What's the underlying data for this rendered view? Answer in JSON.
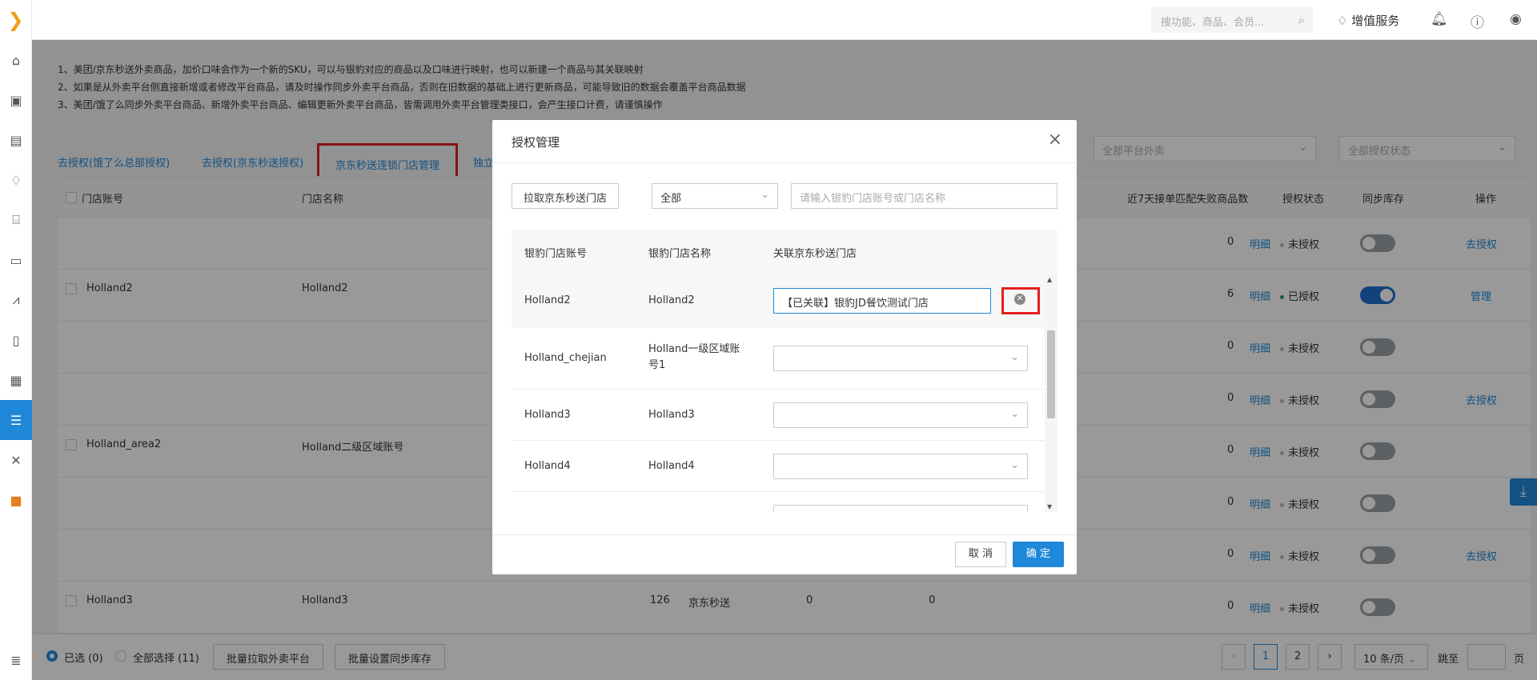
{
  "topbar": {
    "search_placeholder": "搜功能、商品、会员...",
    "value_added": "增值服务"
  },
  "icons": {
    "logo": "logo-icon",
    "search": "search-icon",
    "diamond": "diamond-icon",
    "bell": "bell-icon",
    "help": "help-icon",
    "user": "user-icon",
    "close": "close-icon",
    "clear": "clear-icon",
    "chevron": "chevron-down-icon",
    "download": "download-icon"
  },
  "sidebar": {
    "items": [
      "home-icon",
      "cashier-icon",
      "product-icon",
      "member-icon",
      "store-icon",
      "card-icon",
      "report-icon",
      "document-icon",
      "finance-icon",
      "settings-icon",
      "tools-icon",
      "apps-icon",
      "search-list-icon"
    ]
  },
  "notice": {
    "line1": "1、美团/京东秒送外卖商品，加价口味会作为一个新的SKU，可以与银豹对应的商品以及口味进行映射，也可以新建一个商品与其关联映射",
    "line2": "2、如果是从外卖平台侧直接新增或者修改平台商品，请及时操作同步外卖平台商品，否则在旧数据的基础上进行更新商品，可能导致旧的数据会覆盖平台商品数据",
    "line3": "3、美团/饿了么同步外卖平台商品、新增外卖平台商品、编辑更新外卖平台商品，皆需调用外卖平台管理类接口，会产生接口计费，请谨慎操作"
  },
  "tabs": {
    "t1": "去授权(饿了么总部授权)",
    "t2": "去授权(京东秒送授权)",
    "t3": "京东秒送连锁门店管理",
    "t4": "独立"
  },
  "filters": {
    "platform": "全部平台外卖",
    "auth_status": "全部授权状态",
    "partial": "3"
  },
  "table": {
    "headers": {
      "account": "门店账号",
      "name": "门店名称",
      "failed": "近7天接单匹配失败商品数",
      "auth": "授权状态",
      "sync": "同步库存",
      "ops": "操作"
    },
    "detail": "明细",
    "auth_yes": "已授权",
    "auth_no": "未授权",
    "op_auth": "去授权",
    "op_manage": "管理",
    "groups": [
      {
        "account": "Holland2",
        "name": "Holland2"
      },
      {
        "account": "Holland_area2",
        "name": "Holland二级区域账号"
      },
      {
        "account": "Holland3",
        "name": "Holland3",
        "count": "126",
        "platform": "京东秒送",
        "v1": "0",
        "v2": "0"
      }
    ],
    "rows": [
      {
        "fail": "0",
        "on": false,
        "op": "去授权"
      },
      {
        "fail": "6",
        "on": true,
        "op": "管理"
      },
      {
        "fail": "0",
        "on": false,
        "op": ""
      },
      {
        "fail": "0",
        "on": false,
        "op": "去授权"
      },
      {
        "fail": "0",
        "on": false,
        "op": ""
      },
      {
        "fail": "0",
        "on": false,
        "op": ""
      },
      {
        "fail": "0",
        "on": false,
        "op": "去授权"
      },
      {
        "fail": "0",
        "on": false,
        "op": ""
      }
    ]
  },
  "footer": {
    "selected": "已选 (0)",
    "select_all": "全部选择 (11)",
    "batch_pull": "批量拉取外卖平台",
    "batch_sync": "批量设置同步库存",
    "page1": "1",
    "page2": "2",
    "page_size": "10 条/页",
    "jump": "跳至",
    "page_unit": "页"
  },
  "modal": {
    "title": "授权管理",
    "pull_button": "拉取京东秒送门店",
    "filter_value": "全部",
    "search_placeholder": "请输入银豹门店账号或门店名称",
    "headers": {
      "account": "银豹门店账号",
      "name": "银豹门店名称",
      "link": "关联京东秒送门店"
    },
    "rows": [
      {
        "account": "Holland2",
        "name": "Holland2",
        "linked": "【已关联】银豹JD餐饮测试门店"
      },
      {
        "account": "Holland_chejian",
        "name": "Holland一级区域账号1",
        "linked": ""
      },
      {
        "account": "Holland3",
        "name": "Holland3",
        "linked": ""
      },
      {
        "account": "Holland4",
        "name": "Holland4",
        "linked": ""
      }
    ],
    "cancel": "取 消",
    "ok": "确 定"
  }
}
